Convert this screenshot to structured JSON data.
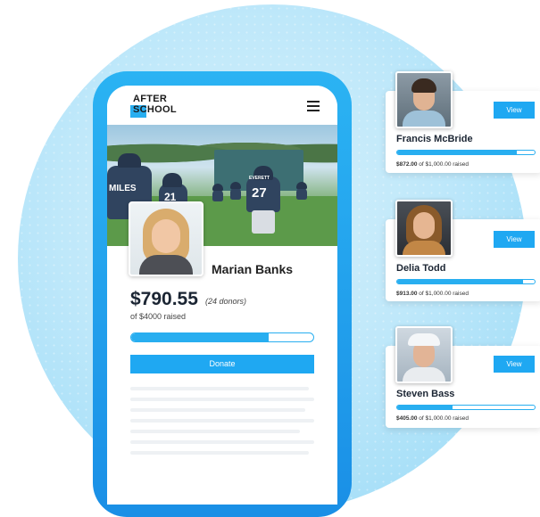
{
  "colors": {
    "accent": "#1fa8f2",
    "bar": "#28aef0",
    "background_circle": "#bfe8fa"
  },
  "phone": {
    "logo": {
      "line1": "AFTER",
      "line2": "SCHOOL"
    },
    "menu_icon": "hamburger-menu-icon",
    "hero_jersey_numbers": [
      "MILES",
      "21",
      "27"
    ],
    "hero_jersey_text": "EVERETT",
    "fundraiser": {
      "name": "Marian Banks",
      "amount": "$790.55",
      "donors": "(24 donors)",
      "raised_text": "of $4000 raised",
      "progress_fraction": 0.755,
      "donate_label": "Donate"
    }
  },
  "cards": [
    {
      "name": "Francis McBride",
      "view_label": "View",
      "raised_amount": "$872.00",
      "raised_rest": " of $1,000.00 raised",
      "progress_fraction": 0.872
    },
    {
      "name": "Delia Todd",
      "view_label": "View",
      "raised_amount": "$913.00",
      "raised_rest": " of $1,000.00 raised",
      "progress_fraction": 0.913
    },
    {
      "name": "Steven Bass",
      "view_label": "View",
      "raised_amount": "$405.00",
      "raised_rest": " of $1,000.00 raised",
      "progress_fraction": 0.405
    }
  ]
}
